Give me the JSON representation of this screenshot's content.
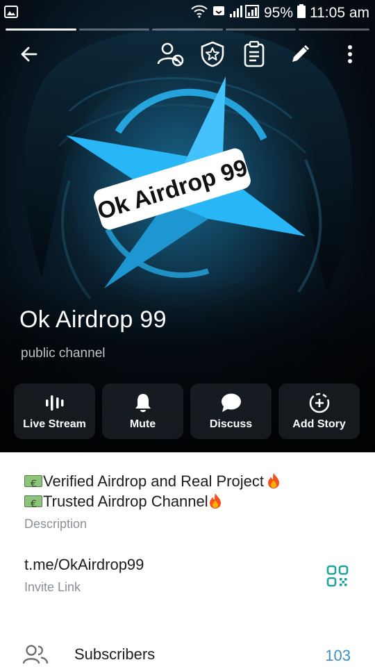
{
  "status_bar": {
    "battery": "95%",
    "time": "11:05 am",
    "icons": [
      "gallery-icon",
      "wifi-icon",
      "screen-mirror-icon",
      "signal-icon",
      "battery-icon"
    ]
  },
  "story_segments": {
    "count": 5,
    "active_index": 0
  },
  "topbar": {
    "icons": [
      "back-arrow-icon",
      "block-user-icon",
      "shield-star-icon",
      "clipboard-icon",
      "pencil-icon",
      "more-vertical-icon"
    ]
  },
  "artwork": {
    "logo_text": "Ok Airdrop 99",
    "accent": "#29b6f6"
  },
  "channel": {
    "title": "Ok Airdrop 99",
    "subtitle": "public channel"
  },
  "actions": [
    {
      "label": "Live Stream",
      "icon": "live-stream-icon"
    },
    {
      "label": "Mute",
      "icon": "bell-icon"
    },
    {
      "label": "Discuss",
      "icon": "chat-bubble-icon"
    },
    {
      "label": "Add Story",
      "icon": "add-story-icon"
    }
  ],
  "info": {
    "description_line1": "Verified Airdrop and Real Project",
    "description_line2": "Trusted Airdrop Channel",
    "description_label": "Description",
    "invite_link": "t.me/OkAirdrop99",
    "invite_label": "Invite Link",
    "subscribers_label": "Subscribers",
    "subscribers_count": "103"
  },
  "colors": {
    "link_accent": "#3a8dc9",
    "qr_accent": "#1ba39a",
    "secondary_text": "#8a8f94"
  }
}
